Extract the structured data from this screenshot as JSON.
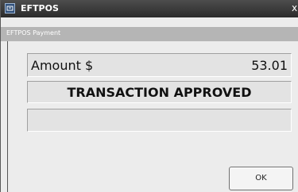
{
  "window": {
    "title": "EFTPOS",
    "subheader": "EFTPOS Payment",
    "close_glyph": "x"
  },
  "payment": {
    "amount_label": "Amount $",
    "amount_value": "53.01",
    "status": "TRANSACTION APPROVED",
    "message": ""
  },
  "buttons": {
    "ok_label": "OK"
  },
  "icons": {
    "app": "eftpos-app-icon",
    "close": "close-icon"
  }
}
